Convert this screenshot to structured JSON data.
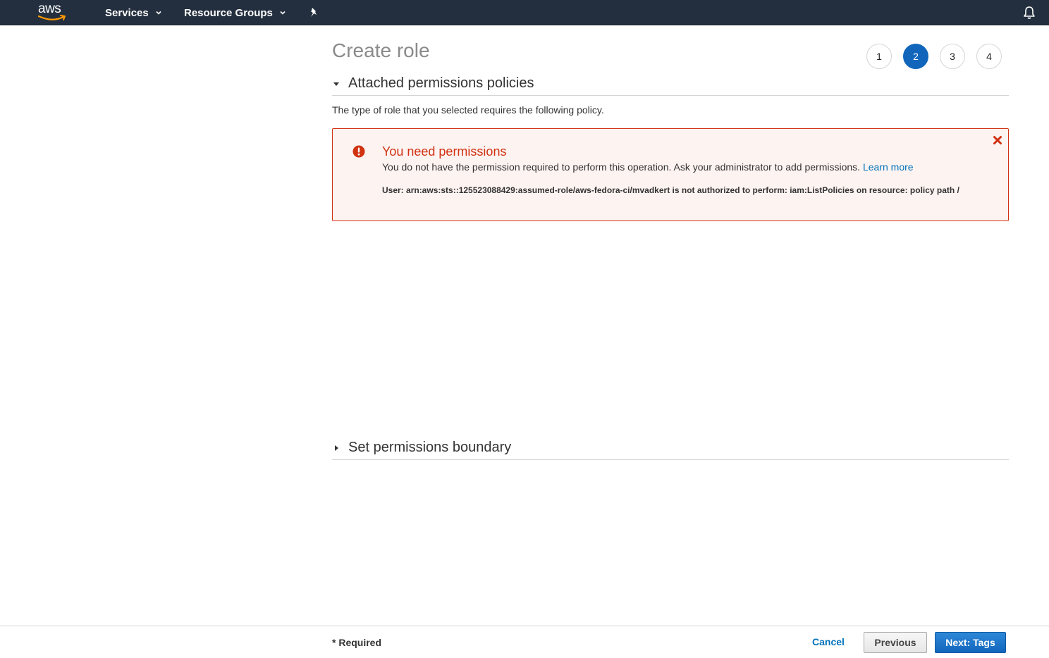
{
  "nav": {
    "logo_text": "aws",
    "services_label": "Services",
    "resource_groups_label": "Resource Groups",
    "pin_icon": "pin-icon",
    "bell_icon": "bell-icon"
  },
  "page": {
    "title": "Create role",
    "steps": [
      "1",
      "2",
      "3",
      "4"
    ],
    "active_step": "2"
  },
  "attached": {
    "heading": "Attached permissions policies",
    "description": "The type of role that you selected requires the following policy."
  },
  "alert": {
    "title": "You need permissions",
    "message": "You do not have the permission required to perform this operation. Ask your administrator to add permissions.",
    "link": "Learn more",
    "detail": "User: arn:aws:sts::125523088429:assumed-role/aws-fedora-ci/mvadkert is not authorized to perform: iam:ListPolicies on resource: policy path /",
    "color": "#d13212"
  },
  "boundary": {
    "heading": "Set permissions boundary"
  },
  "footer": {
    "required": "* Required",
    "cancel": "Cancel",
    "previous": "Previous",
    "next": "Next: Tags"
  },
  "colors": {
    "nav_bg": "#232f3e",
    "accent": "#1166bb",
    "link": "#0073bb"
  }
}
